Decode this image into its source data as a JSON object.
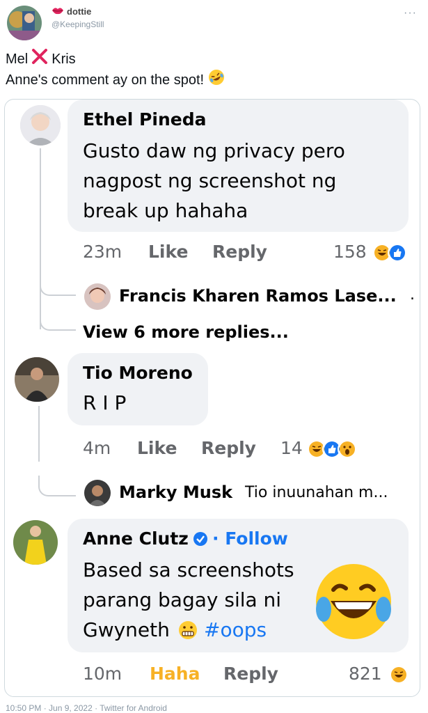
{
  "tweet": {
    "display_name": "dottie",
    "handle": "@KeepingStill",
    "more": "···",
    "line1_a": "Mel",
    "line1_b": "Kris",
    "line2": "Anne's comment ay on the spot!",
    "footer": "10:50 PM · Jun 9, 2022 · Twitter for Android"
  },
  "comments": [
    {
      "name": "Ethel Pineda",
      "lines": [
        "Gusto daw ng privacy pero",
        "nagpost ng screenshot ng",
        "break up hahaha"
      ],
      "time": "23m",
      "like": "Like",
      "reply": "Reply",
      "reactions": "158",
      "reply_preview": {
        "name": "Francis Kharen Ramos Lase...",
        "text": "."
      },
      "view_more": "View 6 more replies..."
    },
    {
      "name": "Tio Moreno",
      "lines": [
        "R I P"
      ],
      "time": "4m",
      "like": "Like",
      "reply": "Reply",
      "reactions": "14",
      "reply_preview": {
        "name": "Marky Musk",
        "text": "Tio inuunahan m..."
      }
    },
    {
      "name": "Anne Clutz",
      "follow": "· Follow",
      "lines": [
        "Based sa screenshots",
        "parang bagay sila ni",
        "Gwyneth"
      ],
      "hashtag": "#oops",
      "time": "10m",
      "haha": "Haha",
      "reply": "Reply",
      "reactions": "821"
    }
  ],
  "colors": {
    "fb_blue": "#1877f2",
    "haha": "#f7b125",
    "bubble": "#f0f2f5",
    "x_red": "#e0245e"
  },
  "icons": [
    "lips-icon",
    "red-x-icon",
    "rolling-laugh-icon",
    "haha-icon",
    "like-icon",
    "wow-icon",
    "verified-badge-icon",
    "crying-laugh-emoji-icon",
    "grimace-emoji-icon"
  ]
}
